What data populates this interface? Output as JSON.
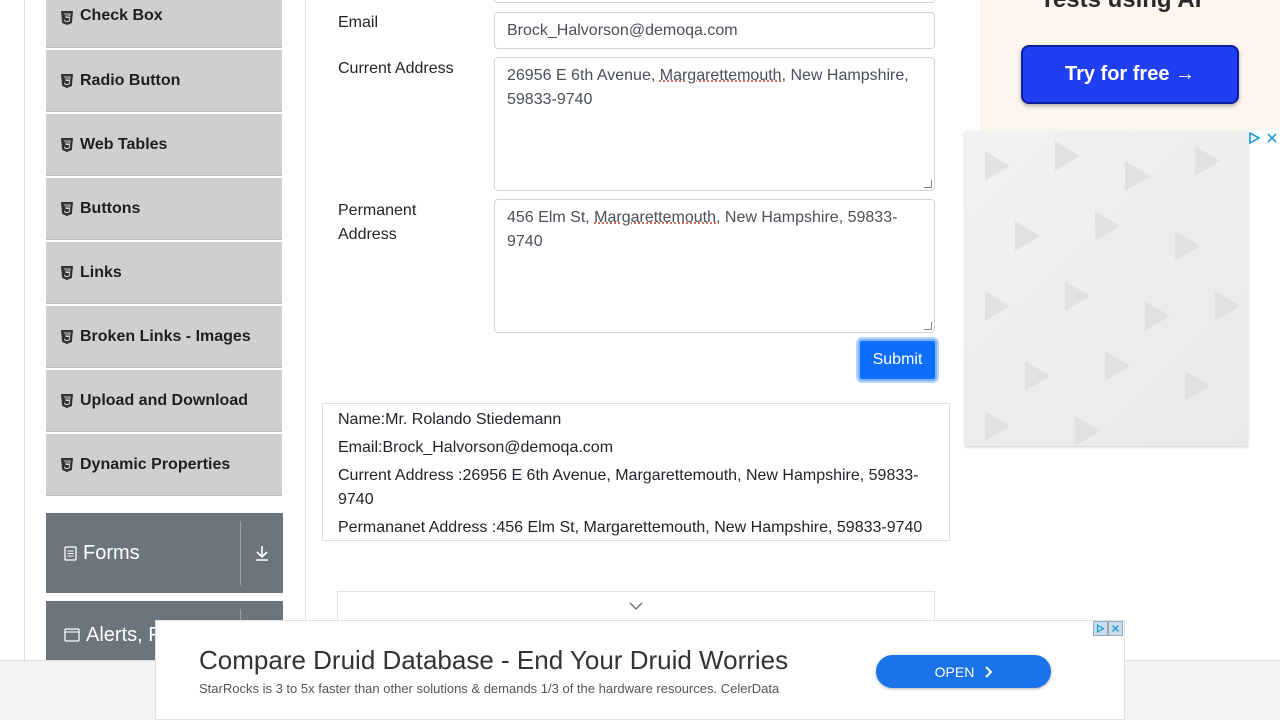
{
  "sidebar": {
    "items": [
      {
        "label": "Check Box"
      },
      {
        "label": "Radio Button"
      },
      {
        "label": "Web Tables"
      },
      {
        "label": "Buttons"
      },
      {
        "label": "Links"
      },
      {
        "label": "Broken Links - Images"
      },
      {
        "label": "Upload and Download"
      },
      {
        "label": "Dynamic Properties"
      }
    ],
    "groups": [
      {
        "label": "Forms"
      },
      {
        "label": "Alerts, F"
      }
    ]
  },
  "form": {
    "email_label": "Email",
    "email_value": "Brock_Halvorson@demoqa.com",
    "current_address_label": "Current Address",
    "current_address": {
      "part1": "26956 E 6th Avenue, ",
      "city": "Margarettemouth",
      "part2": ", New Hampshire, 59833-9740"
    },
    "permanent_address_label_1": "Permanent",
    "permanent_address_label_2": "Address",
    "permanent_address": {
      "part1": "456 Elm St, ",
      "city": "Margarettemouth",
      "part2": ", New Hampshire, 59833-9740"
    },
    "submit_label": "Submit"
  },
  "output": {
    "name": "Name:Mr. Rolando Stiedemann",
    "email": "Email:Brock_Halvorson@demoqa.com",
    "current_address": "Current Address :26956 E 6th Avenue, Margarettemouth, New Hampshire, 59833-9740",
    "permanent_address": "Permananet Address :456 Elm St, Margarettemouth, New Hampshire, 59833-9740"
  },
  "ad_right": {
    "heading": "Tests using AI",
    "button": "Try for free →"
  },
  "ad_bottom": {
    "title": "Compare Druid Database - End Your Druid Worries",
    "description": "StarRocks is 3 to 5x faster than other solutions & demands 1/3 of the hardware resources. CelerData",
    "button": "OPEN"
  }
}
